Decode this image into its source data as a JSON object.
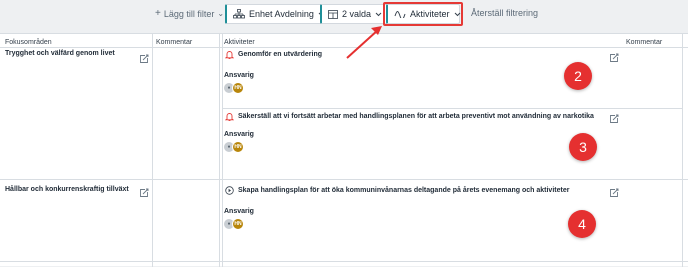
{
  "toolbar": {
    "add_filter": "Lägg till filter",
    "unit_filter": "Enhet Avdelning",
    "table_filter": "2 valda",
    "activities_filter": "Aktiviteter",
    "reset": "Återställ filtrering"
  },
  "table": {
    "headers": {
      "focus": "Fokusområden",
      "comment_left": "Kommentar",
      "activities": "Aktiviteter",
      "comment_right": "Kommentar"
    },
    "focus_areas": [
      {
        "label": "Trygghet och välfärd genom livet"
      },
      {
        "label": "Hållbar och konkurrenskraftig tillväxt"
      }
    ],
    "activities": [
      {
        "title": "Genomför en utvärdering",
        "icon": "bell-icon",
        "responsible_label": "Ansvarig",
        "avatar_initials": "HN",
        "annotation": "2"
      },
      {
        "title": "Säkerställ att vi fortsätt arbetar med handlingsplanen för att arbeta preventivt mot användning av narkotika",
        "icon": "bell-icon",
        "responsible_label": "Ansvarig",
        "avatar_initials": "HN",
        "annotation": "3"
      },
      {
        "title": "Skapa handlingsplan för att öka kommuninvånarnas deltagande på årets evenemang och aktiviteter",
        "icon": "play-circle-icon",
        "responsible_label": "Ansvarig",
        "avatar_initials": "HN",
        "annotation": "4"
      }
    ]
  },
  "colors": {
    "accent": "#1f8f98",
    "annotation": "#e53030",
    "alert_icon": "#e53935",
    "avatar_gold": "#b8860b"
  }
}
